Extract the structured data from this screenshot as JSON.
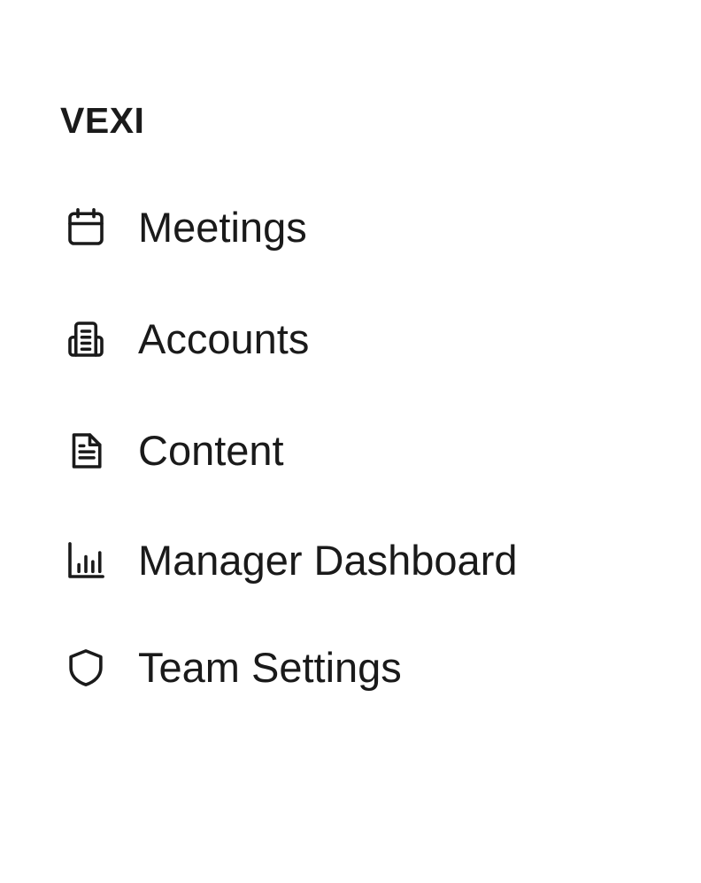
{
  "brand": {
    "name": "VEXI"
  },
  "nav": {
    "items": [
      {
        "label": "Meetings",
        "icon": "calendar-icon"
      },
      {
        "label": "Accounts",
        "icon": "building-icon"
      },
      {
        "label": "Content",
        "icon": "document-icon"
      },
      {
        "label": "Manager Dashboard",
        "icon": "bar-chart-icon"
      },
      {
        "label": "Team Settings",
        "icon": "shield-icon"
      }
    ]
  },
  "colors": {
    "text": "#1a1a1a",
    "background": "#ffffff"
  }
}
